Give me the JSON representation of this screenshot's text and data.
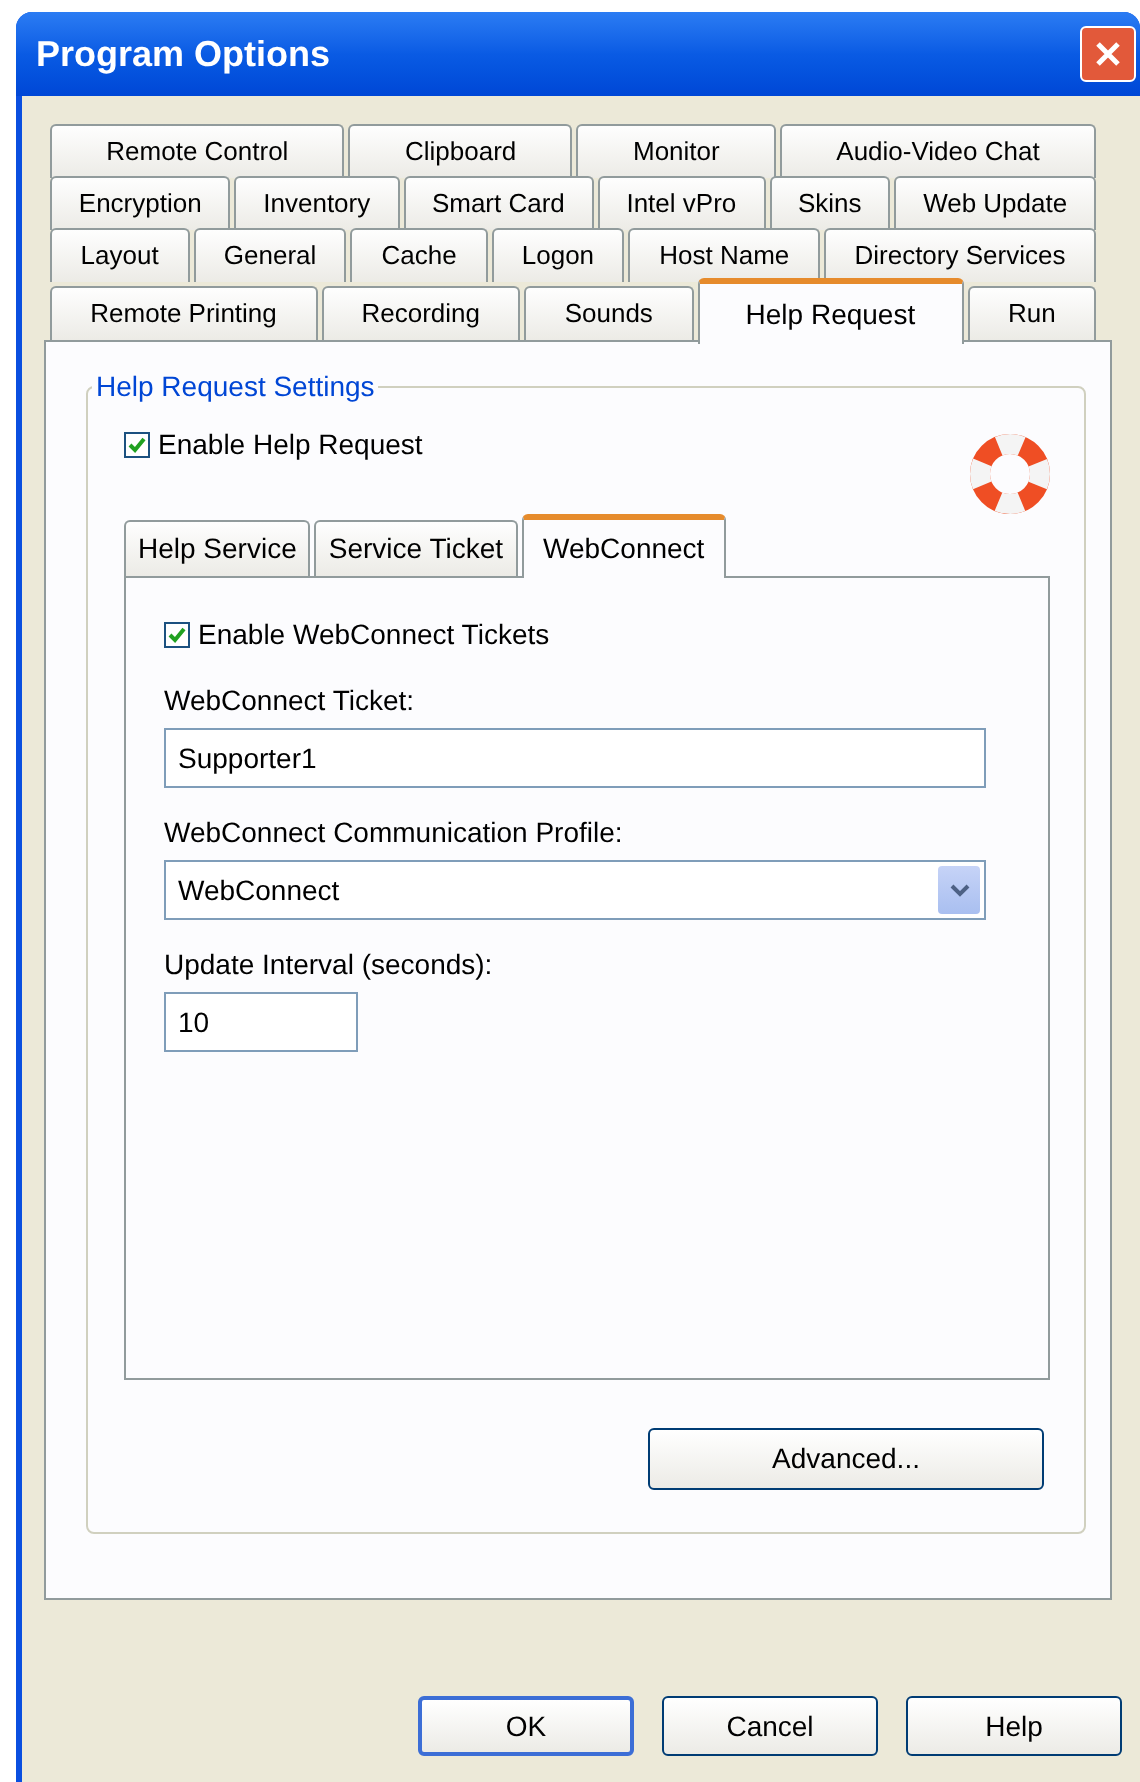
{
  "window": {
    "title": "Program Options"
  },
  "tab_rows": [
    [
      {
        "label": "Remote Control",
        "selected": false
      },
      {
        "label": "Clipboard",
        "selected": false
      },
      {
        "label": "Monitor",
        "selected": false
      },
      {
        "label": "Audio-Video Chat",
        "selected": false
      }
    ],
    [
      {
        "label": "Encryption",
        "selected": false
      },
      {
        "label": "Inventory",
        "selected": false
      },
      {
        "label": "Smart Card",
        "selected": false
      },
      {
        "label": "Intel vPro",
        "selected": false
      },
      {
        "label": "Skins",
        "selected": false
      },
      {
        "label": "Web Update",
        "selected": false
      }
    ],
    [
      {
        "label": "Layout",
        "selected": false
      },
      {
        "label": "General",
        "selected": false
      },
      {
        "label": "Cache",
        "selected": false
      },
      {
        "label": "Logon",
        "selected": false
      },
      {
        "label": "Host Name",
        "selected": false
      },
      {
        "label": "Directory Services",
        "selected": false
      }
    ],
    [
      {
        "label": "Remote Printing",
        "selected": false
      },
      {
        "label": "Recording",
        "selected": false
      },
      {
        "label": "Sounds",
        "selected": false
      },
      {
        "label": "Help Request",
        "selected": true
      },
      {
        "label": "Run",
        "selected": false
      }
    ]
  ],
  "group": {
    "title": "Help Request Settings",
    "enable": {
      "label": "Enable Help Request",
      "checked": true
    },
    "inner_tabs": [
      {
        "label": "Help Service",
        "selected": false
      },
      {
        "label": "Service Ticket",
        "selected": false
      },
      {
        "label": "WebConnect",
        "selected": true
      }
    ],
    "enable_tickets": {
      "label": "Enable WebConnect Tickets",
      "checked": true
    },
    "fields": [
      {
        "kind": "text",
        "label": "WebConnect Ticket:",
        "value": "Supporter1"
      },
      {
        "kind": "dropdown",
        "label": "WebConnect Communication Profile:",
        "value": "WebConnect"
      },
      {
        "kind": "short",
        "label": "Update Interval (seconds):",
        "value": "10"
      }
    ],
    "advanced_button": "Advanced..."
  },
  "buttons": [
    {
      "label": "OK",
      "default": true
    },
    {
      "label": "Cancel",
      "default": false
    },
    {
      "label": "Help",
      "default": false
    }
  ]
}
